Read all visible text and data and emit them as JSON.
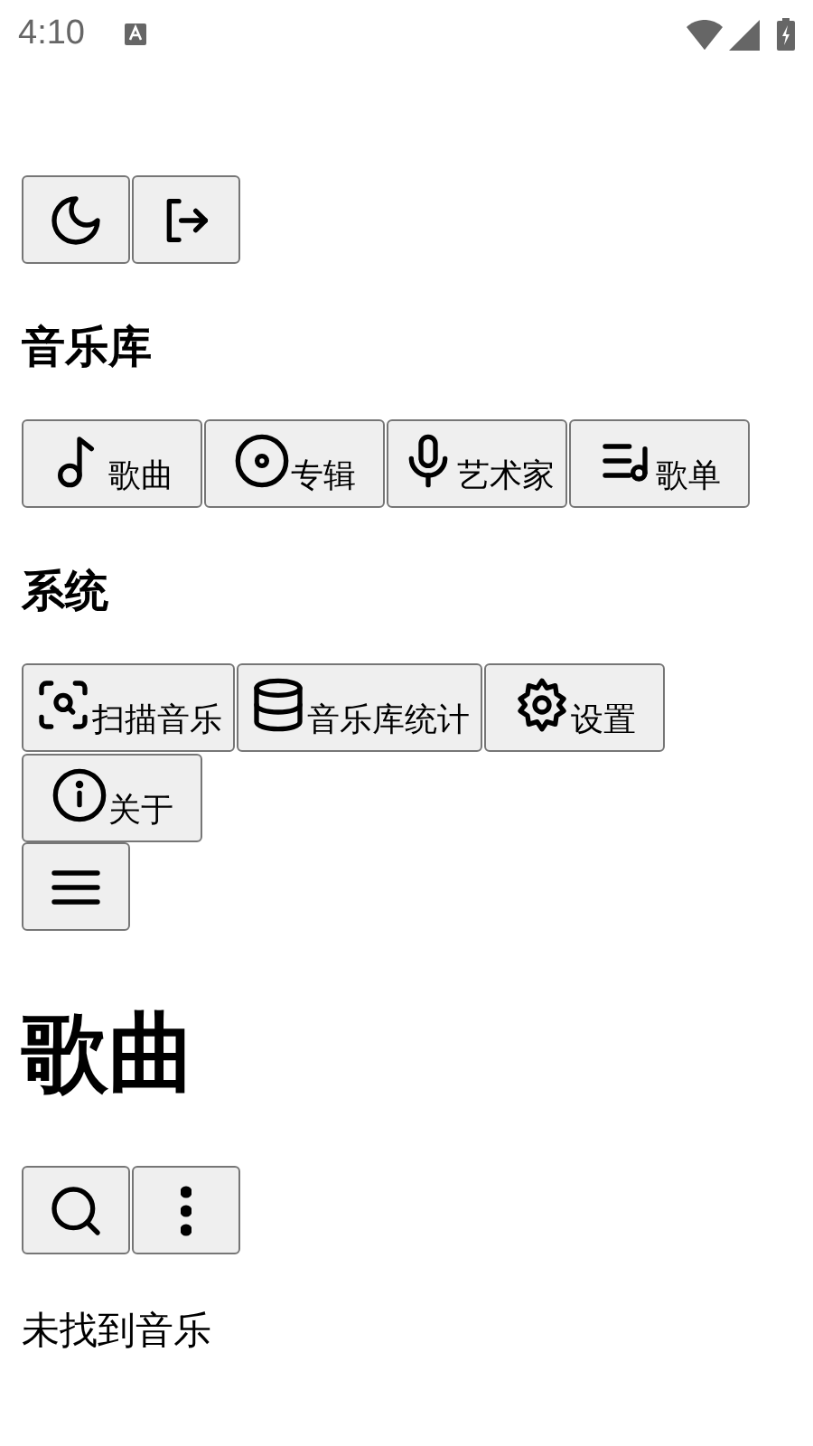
{
  "status_bar": {
    "time": "4:10"
  },
  "top_buttons": [
    {
      "kind": "theme"
    },
    {
      "kind": "logout"
    }
  ],
  "sections": [
    {
      "title": "音乐库",
      "buttons": [
        {
          "kind": "songs",
          "label": "歌曲"
        },
        {
          "kind": "albums",
          "label": "专辑"
        },
        {
          "kind": "artists",
          "label": "艺术家"
        },
        {
          "kind": "playlists",
          "label": "歌单"
        }
      ]
    },
    {
      "title": "系统",
      "buttons": [
        {
          "kind": "scan",
          "label": "扫描音乐"
        },
        {
          "kind": "stats",
          "label": "音乐库统计"
        },
        {
          "kind": "settings",
          "label": "设置"
        },
        {
          "kind": "about",
          "label": "关于"
        }
      ]
    }
  ],
  "menu_button": {
    "kind": "menu"
  },
  "page_title": "歌曲",
  "toolbar_buttons": [
    {
      "kind": "search"
    },
    {
      "kind": "more"
    }
  ],
  "empty_message": "未找到音乐"
}
